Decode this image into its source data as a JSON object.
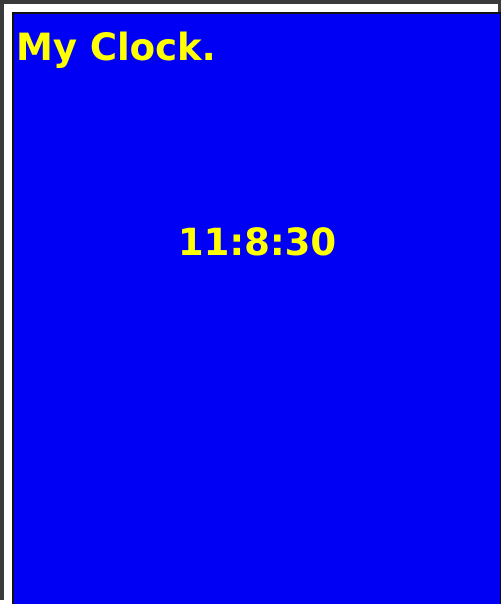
{
  "app": {
    "title": "My Clock."
  },
  "clock": {
    "time": "11:8:30"
  },
  "colors": {
    "background": "#0000F4",
    "text": "#FFFF00",
    "border": "#111111"
  }
}
